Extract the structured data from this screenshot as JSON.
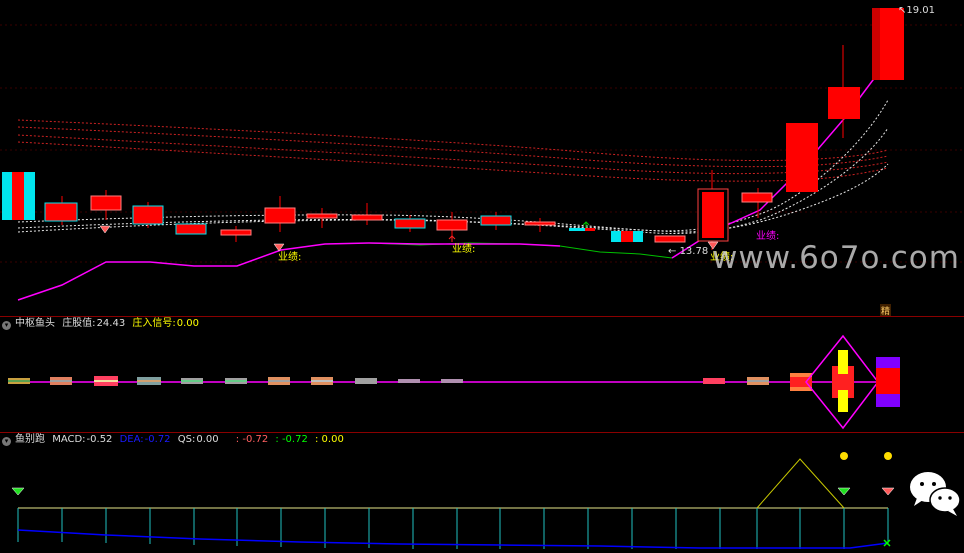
{
  "main_panel": {
    "price_labels": {
      "high": "19.01",
      "low": "13.78"
    },
    "performance_label": "业绩:",
    "corner_badge": "精",
    "watermark": "www.6o7o.com"
  },
  "indicator1": {
    "title": "中枢鱼头",
    "field1_label": "庄股值:",
    "field1_value": "24.43",
    "field2_label": "庄入信号:",
    "field2_value": "0.00"
  },
  "indicator2": {
    "title": "鱼别跑",
    "macd_label": "MACD:",
    "macd_value": "-0.52",
    "dea_label": "DEA:",
    "dea_value": "-0.72",
    "qs_label": "QS:",
    "qs_value": "0.00",
    "extra1": ": -0.72",
    "extra2": ": -0.72",
    "extra3": ": 0.00"
  },
  "colors": {
    "background": "#000000",
    "up_candle": "#ff0000",
    "down_candle": "#00e5ee",
    "trend_line": "#ff00ff",
    "divider": "#8a0000",
    "label_yellow": "#ffff00",
    "macd_blue": "#0000ff",
    "green": "#00ff00"
  },
  "icons": [
    "collapse-icon",
    "diamond-icon",
    "dot-icon",
    "x-mark-icon",
    "wechat-icon",
    "arrow-icon"
  ]
}
